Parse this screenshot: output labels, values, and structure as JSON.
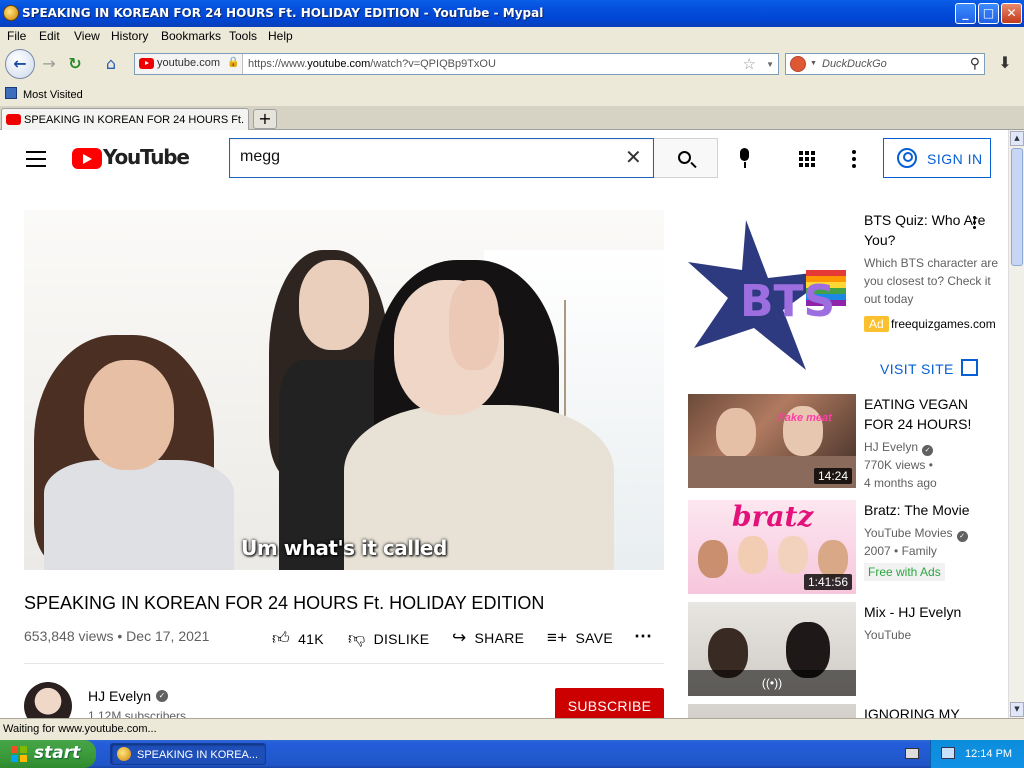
{
  "window": {
    "title": "SPEAKING IN KOREAN FOR 24 HOURS Ft. HOLIDAY EDITION - YouTube - Mypal",
    "minimize_glyph": "_",
    "maximize_glyph": "□",
    "close_glyph": "✕"
  },
  "menu": [
    "File",
    "Edit",
    "View",
    "History",
    "Bookmarks",
    "Tools",
    "Help"
  ],
  "nav": {
    "identity_label": "youtube.com",
    "url_prefix": "https://www.",
    "url_domain": "youtube.com",
    "url_path": "/watch?v=QPIQBp9TxOU",
    "search_engine_placeholder": "DuckDuckGo"
  },
  "bookmarks": {
    "most_visited": "Most Visited"
  },
  "tabs": [
    {
      "label": "SPEAKING IN KOREAN FOR 24 HOURS Ft. H..."
    }
  ],
  "youtube": {
    "logo_text": "YouTube",
    "search_value": "megg",
    "sign_in": "SIGN IN",
    "video": {
      "caption": "Um what's it called",
      "title": "SPEAKING IN KOREAN FOR 24 HOURS Ft. HOLIDAY EDITION",
      "meta": "653,848 views • Dec 17, 2021",
      "likes": "41K",
      "dislike": "DISLIKE",
      "share": "SHARE",
      "save": "SAVE"
    },
    "channel": {
      "name": "HJ Evelyn",
      "subscribers": "1.12M subscribers",
      "subscribe": "SUBSCRIBE"
    },
    "ad": {
      "title": "BTS Quiz: Who Are You?",
      "description": "Which BTS character are you closest to? Check it out today",
      "badge": "Ad",
      "domain": "freequizgames.com",
      "visit": "VISIT SITE",
      "thumb_text": "BTS"
    },
    "recommendations": [
      {
        "title": "EATING VEGAN FOR 24 HOURS!",
        "channel": "HJ Evelyn",
        "views": "770K views •",
        "age": "4 months ago",
        "duration": "14:24",
        "overlay": "Fake meat"
      },
      {
        "title": "Bratz: The Movie",
        "channel": "YouTube Movies",
        "meta": "2007 • Family",
        "badge": "Free with Ads",
        "duration": "1:41:56",
        "overlay": "bratz"
      },
      {
        "title": "Mix - HJ Evelyn",
        "channel": "YouTube",
        "overlay": "((•))"
      },
      {
        "title": "IGNORING MY"
      }
    ]
  },
  "status": "Waiting for www.youtube.com...",
  "taskbar": {
    "start": "start",
    "item": "SPEAKING IN KOREA...",
    "clock": "12:14 PM"
  }
}
